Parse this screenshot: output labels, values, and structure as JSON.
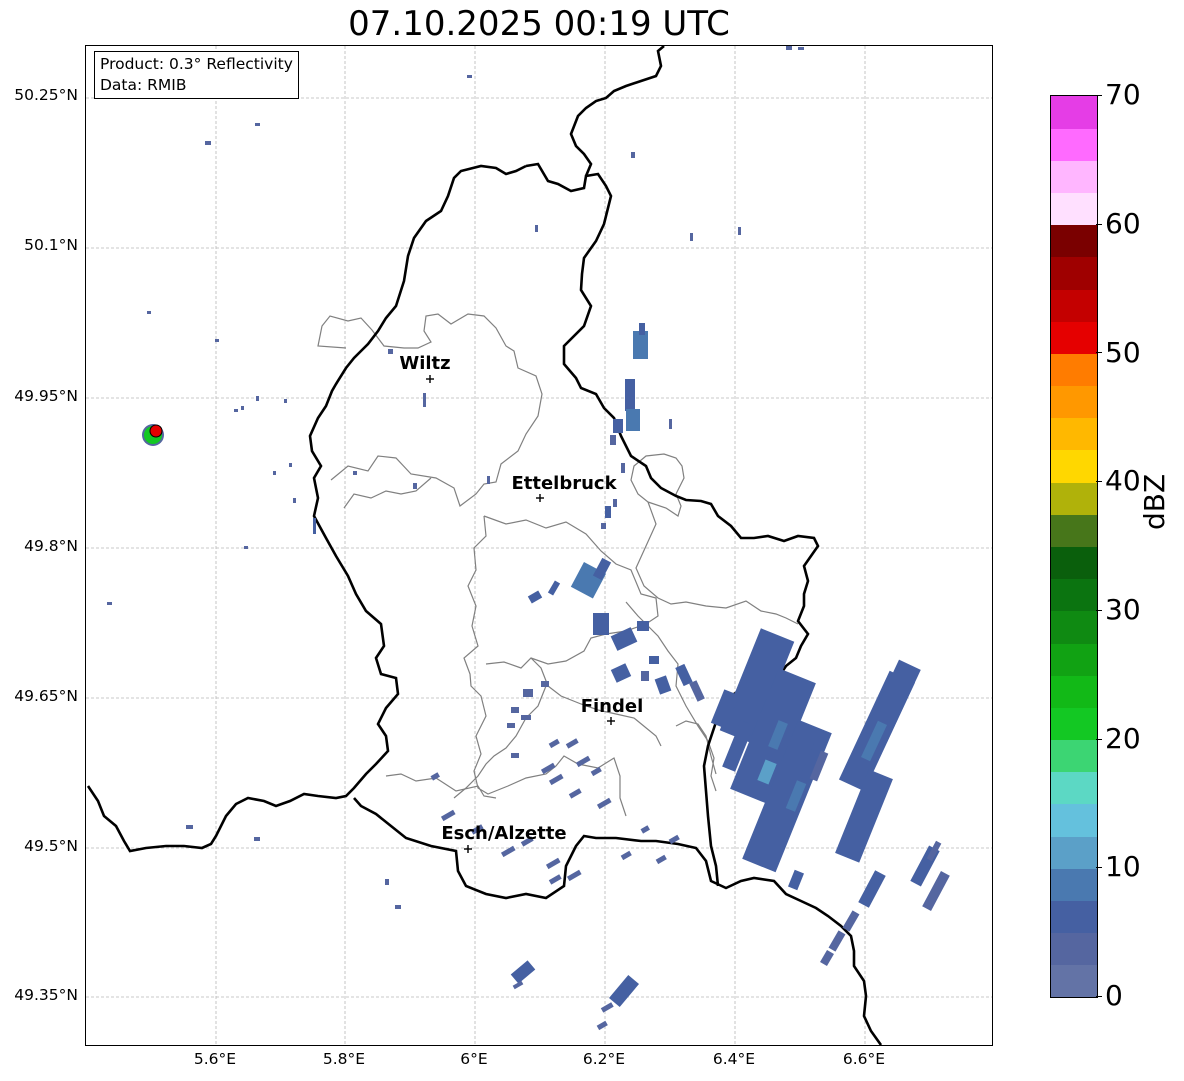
{
  "title": "07.10.2025 00:19 UTC",
  "info_box": {
    "product": "Product: 0.3° Reflectivity",
    "data_source": "Data: RMIB"
  },
  "axes": {
    "lat_ticks": [
      "50.25°N",
      "50.1°N",
      "49.95°N",
      "49.8°N",
      "49.65°N",
      "49.5°N",
      "49.35°N"
    ],
    "lon_ticks": [
      "5.6°E",
      "5.8°E",
      "6°E",
      "6.2°E",
      "6.4°E",
      "6.6°E"
    ]
  },
  "cities": [
    {
      "name": "Wiltz",
      "lon": 5.935,
      "lat": 49.966
    },
    {
      "name": "Ettelbruck",
      "lon": 6.104,
      "lat": 49.848
    },
    {
      "name": "Findel",
      "lon": 6.209,
      "lat": 49.626
    },
    {
      "name": "Esch/Alzette",
      "lon": 5.981,
      "lat": 49.497
    }
  ],
  "colorbar": {
    "unit": "dBZ",
    "ticks": [
      "0",
      "10",
      "20",
      "30",
      "40",
      "50",
      "60",
      "70"
    ],
    "colors": [
      "#6373a6",
      "#5566a0",
      "#4560a2",
      "#4a79b0",
      "#5ba0c8",
      "#64c1dd",
      "#5cd8c4",
      "#3cd573",
      "#13c823",
      "#12b917",
      "#11a213",
      "#0f8a12",
      "#0b7410",
      "#0a5f0c",
      "#47761a",
      "#b0b20a",
      "#ffd700",
      "#ffb800",
      "#ff9800",
      "#ff7c00",
      "#e50000",
      "#c40000",
      "#9f0000",
      "#7a0000",
      "#ffe0ff",
      "#ffb6ff",
      "#ff6aff",
      "#e53de6"
    ]
  },
  "radar_site": {
    "lon": 5.505,
    "lat": 49.914
  }
}
